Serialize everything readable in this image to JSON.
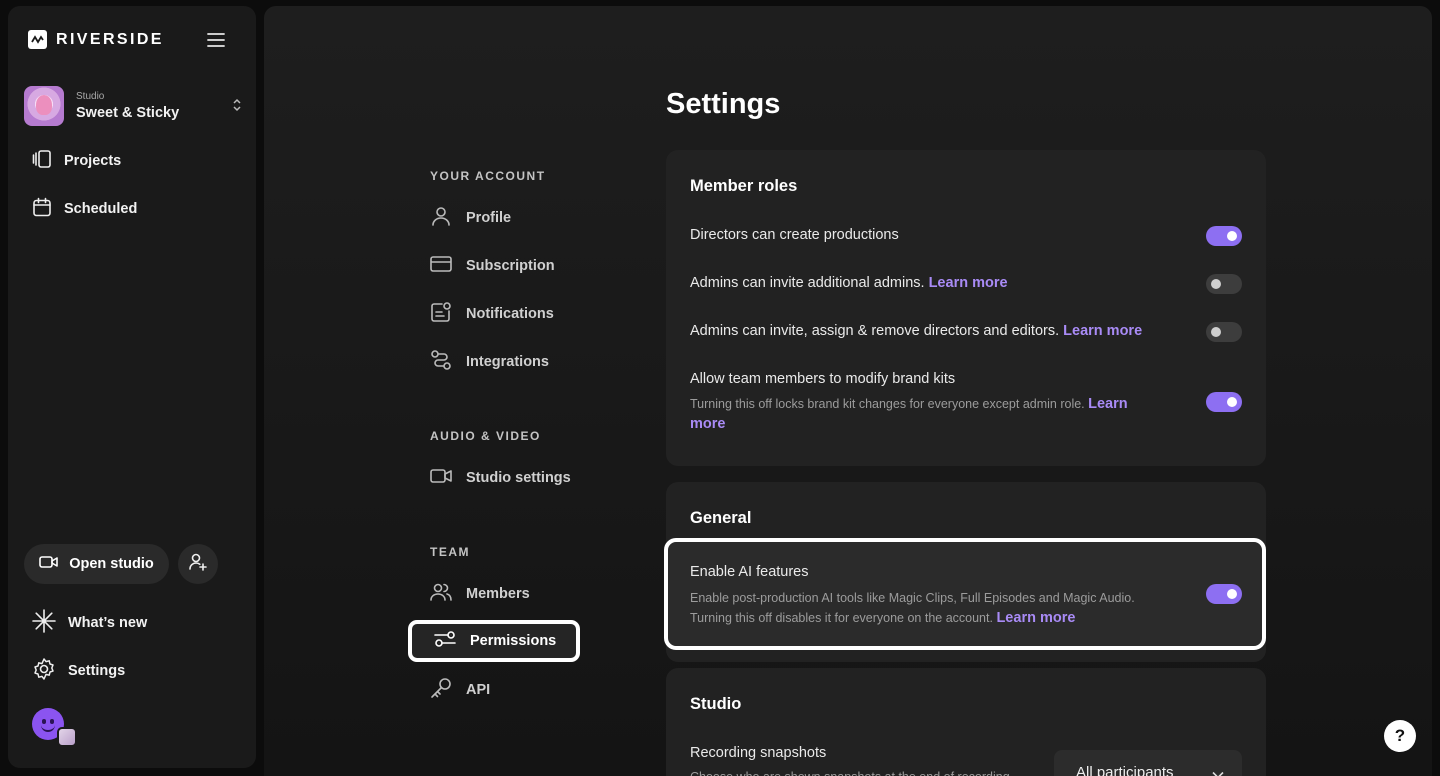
{
  "brand": {
    "name": "RIVERSIDE"
  },
  "studio": {
    "label": "Studio",
    "name": "Sweet & Sticky"
  },
  "sidebar": {
    "items": [
      {
        "label": "Projects",
        "icon": "projects-icon"
      },
      {
        "label": "Scheduled",
        "icon": "calendar-icon"
      }
    ],
    "open_studio": "Open studio",
    "whats_new": "What’s new",
    "settings": "Settings"
  },
  "settings": {
    "title": "Settings",
    "nav": {
      "your_account": {
        "label": "YOUR ACCOUNT",
        "items": [
          "Profile",
          "Subscription",
          "Notifications",
          "Integrations"
        ]
      },
      "audio_video": {
        "label": "AUDIO & VIDEO",
        "items": [
          "Studio settings"
        ]
      },
      "team": {
        "label": "TEAM",
        "items": [
          "Members",
          "Permissions",
          "API"
        ],
        "active": "Permissions"
      }
    },
    "member_roles": {
      "title": "Member roles",
      "rows": [
        {
          "label": "Directors can create productions",
          "enabled": true
        },
        {
          "label": "Admins can invite additional admins.",
          "link": "Learn more",
          "enabled": false
        },
        {
          "label": "Admins can invite, assign & remove directors and editors.",
          "link": "Learn more",
          "enabled": false
        },
        {
          "label": "Allow team members to modify brand kits",
          "description": "Turning this off locks brand kit changes for everyone except admin role.",
          "link": "Learn more",
          "enabled": true
        }
      ]
    },
    "general": {
      "title": "General",
      "rows": [
        {
          "label": "Enable AI features",
          "description_line1": "Enable post-production AI tools like Magic Clips, Full Episodes and Magic Audio.",
          "description_line2": "Turning this off disables it for everyone on the account.",
          "link": "Learn more",
          "enabled": true
        }
      ]
    },
    "studio": {
      "title": "Studio",
      "rows": [
        {
          "label": "Recording snapshots",
          "description": "Choose who are shown snapshots at the end of recording",
          "select_value": "All participants"
        }
      ]
    }
  },
  "help": {
    "label": "?"
  },
  "colors": {
    "accent": "#8d6ff2",
    "link": "#a98bf6",
    "panel": "#222222",
    "background": "#0c0c0c"
  }
}
